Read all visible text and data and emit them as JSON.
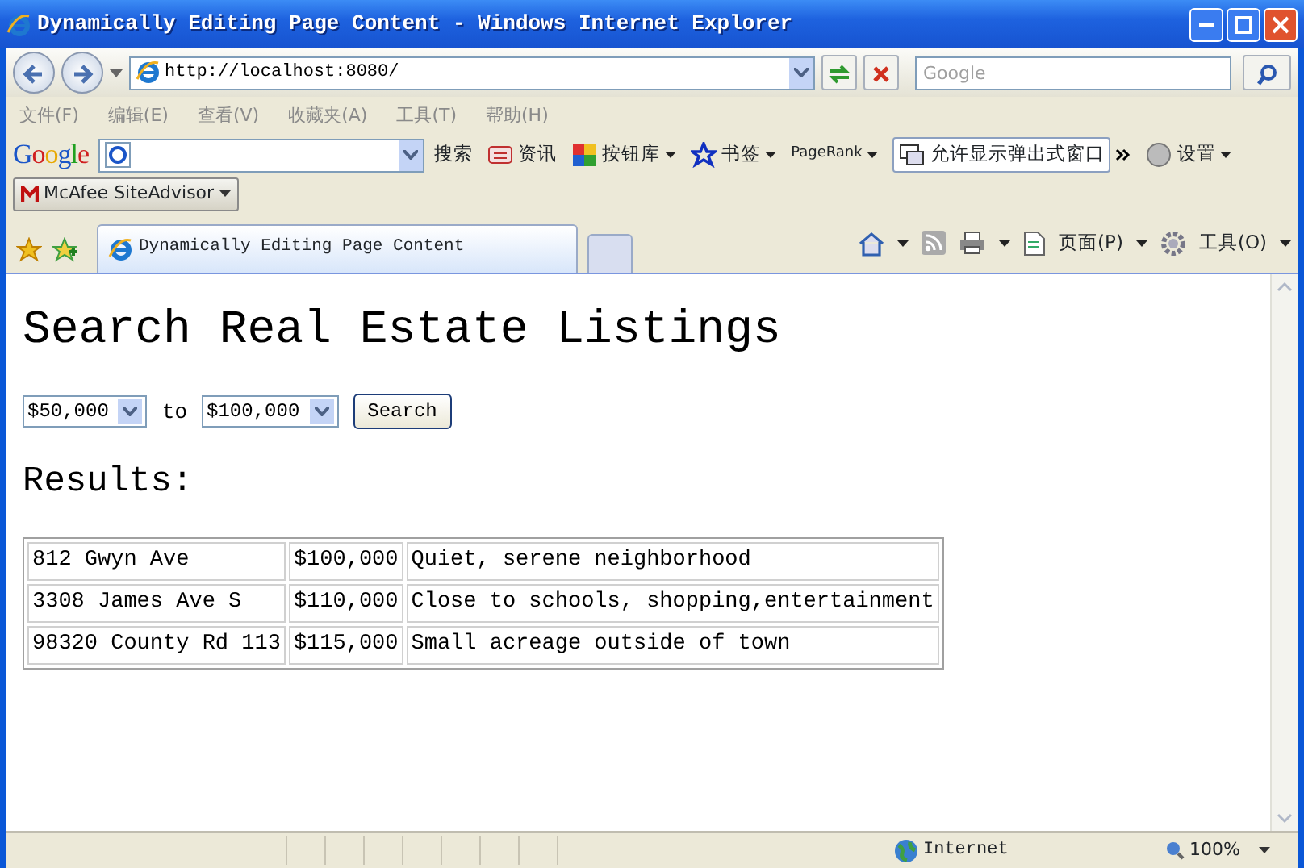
{
  "window": {
    "title": "Dynamically Editing Page Content - Windows Internet Explorer"
  },
  "address_bar": {
    "url": "http://localhost:8080/",
    "search_placeholder": "Google"
  },
  "menu": [
    "文件(F)",
    "编辑(E)",
    "查看(V)",
    "收藏夹(A)",
    "工具(T)",
    "帮助(H)"
  ],
  "google_toolbar": {
    "logo": "Google",
    "search_button": "搜索",
    "items": [
      {
        "label": "资讯",
        "kind": "news"
      },
      {
        "label": "按钮库",
        "kind": "buttons"
      },
      {
        "label": "书签",
        "kind": "bookmark"
      },
      {
        "label": "PageRank",
        "kind": "pagerank"
      },
      {
        "label": "允许显示弹出式窗口",
        "kind": "popup"
      },
      {
        "label": "设置",
        "kind": "settings"
      }
    ]
  },
  "mcafee": {
    "label": "McAfee SiteAdvisor"
  },
  "tabs": [
    {
      "label": "Dynamically Editing Page Content",
      "selected": true
    }
  ],
  "command_bar": [
    {
      "label": "页面(P)",
      "kind": "page"
    },
    {
      "label": "工具(O)",
      "kind": "tools"
    }
  ],
  "page": {
    "heading": "Search Real Estate Listings",
    "min_price": "$50,000",
    "separator": "to",
    "max_price": "$100,000",
    "search_button": "Search",
    "results_heading": "Results:",
    "rows": [
      {
        "address": "812 Gwyn Ave",
        "price": "$100,000",
        "description": "Quiet, serene neighborhood"
      },
      {
        "address": "3308 James Ave S",
        "price": "$110,000",
        "description": "Close to schools, shopping,entertainment"
      },
      {
        "address": "98320 County Rd 113",
        "price": "$115,000",
        "description": "Small acreage outside of town"
      }
    ]
  },
  "status_bar": {
    "zone": "Internet",
    "zoom": "100%"
  }
}
